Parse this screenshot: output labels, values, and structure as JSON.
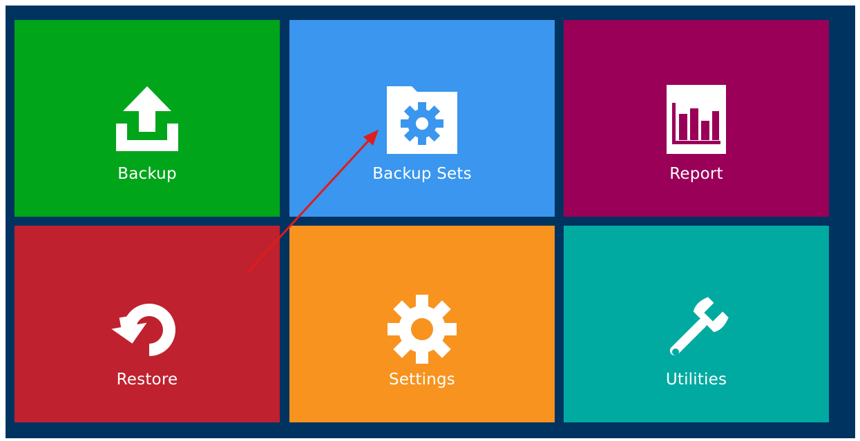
{
  "tiles": [
    {
      "label": "Backup",
      "icon": "upload-icon",
      "color": "#00a51a"
    },
    {
      "label": "Backup Sets",
      "icon": "folder-gear-icon",
      "color": "#3a96ee"
    },
    {
      "label": "Report",
      "icon": "bar-chart-icon",
      "color": "#9a0058"
    },
    {
      "label": "Restore",
      "icon": "restore-icon",
      "color": "#c0212f"
    },
    {
      "label": "Settings",
      "icon": "gear-icon",
      "color": "#f7931e"
    },
    {
      "label": "Utilities",
      "icon": "wrench-icon",
      "color": "#00aaa0"
    }
  ],
  "background_color": "#00335f",
  "annotation": {
    "type": "red-arrow",
    "color": "#e01c1c",
    "target": "Backup Sets"
  }
}
